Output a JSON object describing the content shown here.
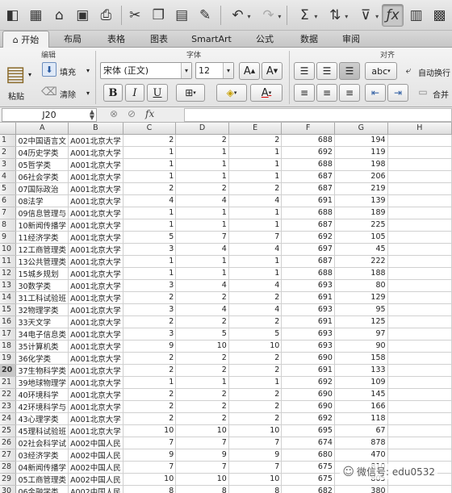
{
  "ribbon_tabs": [
    {
      "label": "开始",
      "active": true
    },
    {
      "label": "布局"
    },
    {
      "label": "表格"
    },
    {
      "label": "图表"
    },
    {
      "label": "SmartArt"
    },
    {
      "label": "公式"
    },
    {
      "label": "数据"
    },
    {
      "label": "审阅"
    }
  ],
  "ribbon": {
    "edit_group": "编辑",
    "font_group": "字体",
    "align_group": "对齐",
    "paste_label": "粘贴",
    "fill_label": "填充",
    "clear_label": "清除",
    "font_name": "宋体 (正文)",
    "font_size": "12",
    "bold": "B",
    "italic": "I",
    "underline": "U",
    "wrap_label": "自动换行",
    "merge_label": "合并",
    "abc_label": "abc"
  },
  "formula_bar": {
    "name_box": "J20",
    "fx": "fx",
    "value": ""
  },
  "grid": {
    "columns": [
      "A",
      "B",
      "C",
      "D",
      "E",
      "F",
      "G",
      "H"
    ],
    "rows": [
      {
        "n": "1",
        "a": "02中国语言文",
        "b": "A001北京大学",
        "c": "2",
        "d": "2",
        "e": "2",
        "f": "688",
        "g": "194"
      },
      {
        "n": "2",
        "a": "04历史学类",
        "b": "A001北京大学",
        "c": "1",
        "d": "1",
        "e": "1",
        "f": "692",
        "g": "119"
      },
      {
        "n": "3",
        "a": "05哲学类",
        "b": "A001北京大学",
        "c": "1",
        "d": "1",
        "e": "1",
        "f": "688",
        "g": "198"
      },
      {
        "n": "4",
        "a": "06社会学类",
        "b": "A001北京大学",
        "c": "1",
        "d": "1",
        "e": "1",
        "f": "687",
        "g": "206"
      },
      {
        "n": "5",
        "a": "07国际政治",
        "b": "A001北京大学",
        "c": "2",
        "d": "2",
        "e": "2",
        "f": "687",
        "g": "219"
      },
      {
        "n": "6",
        "a": "08法学",
        "b": "A001北京大学",
        "c": "4",
        "d": "4",
        "e": "4",
        "f": "691",
        "g": "139"
      },
      {
        "n": "7",
        "a": "09信息管理与",
        "b": "A001北京大学",
        "c": "1",
        "d": "1",
        "e": "1",
        "f": "688",
        "g": "189"
      },
      {
        "n": "8",
        "a": "10新闻传播学",
        "b": "A001北京大学",
        "c": "1",
        "d": "1",
        "e": "1",
        "f": "687",
        "g": "225"
      },
      {
        "n": "9",
        "a": "11经济学类",
        "b": "A001北京大学",
        "c": "5",
        "d": "7",
        "e": "7",
        "f": "692",
        "g": "105"
      },
      {
        "n": "10",
        "a": "12工商管理类",
        "b": "A001北京大学",
        "c": "3",
        "d": "4",
        "e": "4",
        "f": "697",
        "g": "45"
      },
      {
        "n": "11",
        "a": "13公共管理类",
        "b": "A001北京大学",
        "c": "1",
        "d": "1",
        "e": "1",
        "f": "687",
        "g": "222"
      },
      {
        "n": "12",
        "a": "15城乡规划",
        "b": "A001北京大学",
        "c": "1",
        "d": "1",
        "e": "1",
        "f": "688",
        "g": "188"
      },
      {
        "n": "13",
        "a": "30数学类",
        "b": "A001北京大学",
        "c": "3",
        "d": "4",
        "e": "4",
        "f": "693",
        "g": "80"
      },
      {
        "n": "14",
        "a": "31工科试验班",
        "b": "A001北京大学",
        "c": "2",
        "d": "2",
        "e": "2",
        "f": "691",
        "g": "129"
      },
      {
        "n": "15",
        "a": "32物理学类",
        "b": "A001北京大学",
        "c": "3",
        "d": "4",
        "e": "4",
        "f": "693",
        "g": "95"
      },
      {
        "n": "16",
        "a": "33天文学",
        "b": "A001北京大学",
        "c": "2",
        "d": "2",
        "e": "2",
        "f": "691",
        "g": "125"
      },
      {
        "n": "17",
        "a": "34电子信息类",
        "b": "A001北京大学",
        "c": "3",
        "d": "5",
        "e": "5",
        "f": "693",
        "g": "97"
      },
      {
        "n": "18",
        "a": "35计算机类",
        "b": "A001北京大学",
        "c": "9",
        "d": "10",
        "e": "10",
        "f": "693",
        "g": "90"
      },
      {
        "n": "19",
        "a": "36化学类",
        "b": "A001北京大学",
        "c": "2",
        "d": "2",
        "e": "2",
        "f": "690",
        "g": "158"
      },
      {
        "n": "20",
        "a": "37生物科学类",
        "b": "A001北京大学",
        "c": "2",
        "d": "2",
        "e": "2",
        "f": "691",
        "g": "133",
        "sel": true
      },
      {
        "n": "21",
        "a": "39地球物理学",
        "b": "A001北京大学",
        "c": "1",
        "d": "1",
        "e": "1",
        "f": "692",
        "g": "109"
      },
      {
        "n": "22",
        "a": "40环境科学",
        "b": "A001北京大学",
        "c": "2",
        "d": "2",
        "e": "2",
        "f": "690",
        "g": "145"
      },
      {
        "n": "23",
        "a": "42环境科学与",
        "b": "A001北京大学",
        "c": "2",
        "d": "2",
        "e": "2",
        "f": "690",
        "g": "166"
      },
      {
        "n": "24",
        "a": "43心理学类",
        "b": "A001北京大学",
        "c": "2",
        "d": "2",
        "e": "2",
        "f": "692",
        "g": "118"
      },
      {
        "n": "25",
        "a": "45理科试验班",
        "b": "A001北京大学",
        "c": "10",
        "d": "10",
        "e": "10",
        "f": "695",
        "g": "67"
      },
      {
        "n": "26",
        "a": "02社会科学试",
        "b": "A002中国人民",
        "c": "7",
        "d": "7",
        "e": "7",
        "f": "674",
        "g": "878"
      },
      {
        "n": "27",
        "a": "03经济学类",
        "b": "A002中国人民",
        "c": "9",
        "d": "9",
        "e": "9",
        "f": "680",
        "g": "470"
      },
      {
        "n": "28",
        "a": "04新闻传播学",
        "b": "A002中国人民",
        "c": "7",
        "d": "7",
        "e": "7",
        "f": "675",
        "g": "810"
      },
      {
        "n": "29",
        "a": "05工商管理类",
        "b": "A002中国人民",
        "c": "10",
        "d": "10",
        "e": "10",
        "f": "675",
        "g": "805"
      },
      {
        "n": "30",
        "a": "06金融学类",
        "b": "A002中国人民",
        "c": "8",
        "d": "8",
        "e": "8",
        "f": "682",
        "g": "380"
      }
    ]
  },
  "watermark": "微信号: edu0532"
}
